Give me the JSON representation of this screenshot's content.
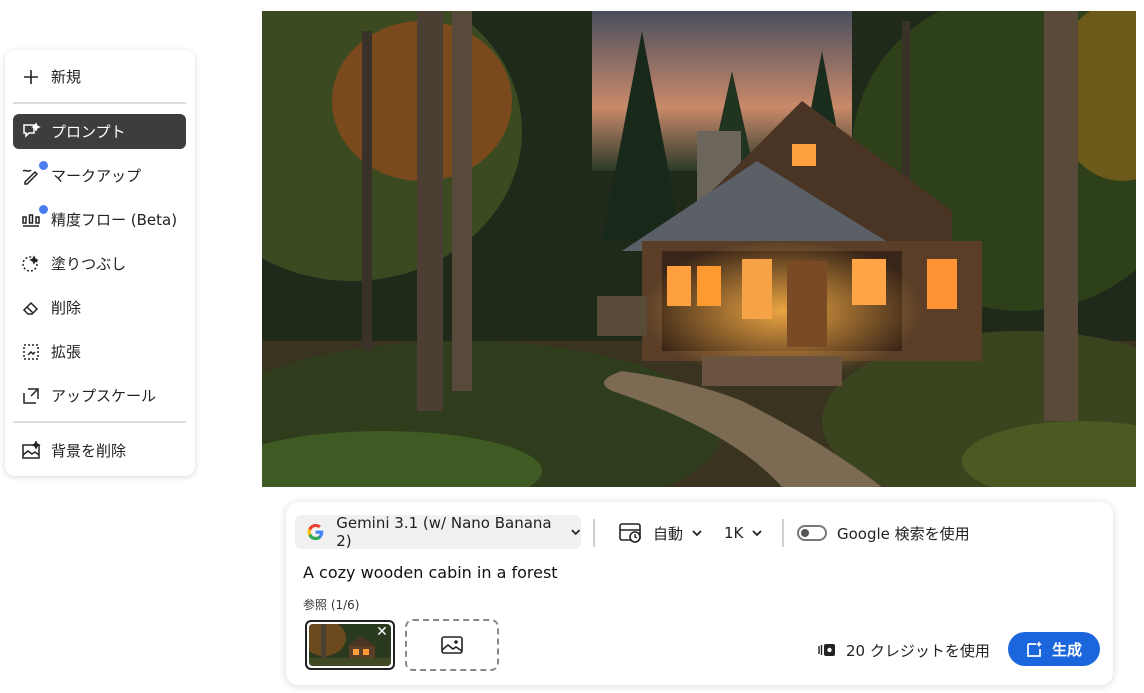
{
  "tools": {
    "new_label": "新規",
    "items": [
      {
        "label": "プロンプト",
        "icon": "prompt-icon",
        "active": true
      },
      {
        "label": "マークアップ",
        "icon": "markup-icon",
        "dot": true
      },
      {
        "label": "精度フロー (Beta)",
        "icon": "precision-flow-icon",
        "dot": true
      },
      {
        "label": "塗りつぶし",
        "icon": "fill-icon"
      },
      {
        "label": "削除",
        "icon": "remove-icon"
      },
      {
        "label": "拡張",
        "icon": "expand-icon"
      },
      {
        "label": "アップスケール",
        "icon": "upscale-icon"
      }
    ],
    "remove_bg_label": "背景を削除"
  },
  "prompt_panel": {
    "model": "Gemini 3.1 (w/ Nano Banana 2)",
    "aspect": "自動",
    "resolution": "1K",
    "google_search_label": "Google 検索を使用",
    "google_search_on": false,
    "prompt": "A cozy wooden cabin in a forest",
    "reference_label": "参照 (1/6)",
    "credits_label": "20 クレジットを使用",
    "generate_label": "生成"
  },
  "colors": {
    "accent": "#1b66dd",
    "active_tool_bg": "#3d3d3d",
    "beta_dot": "#4a7cf0"
  }
}
